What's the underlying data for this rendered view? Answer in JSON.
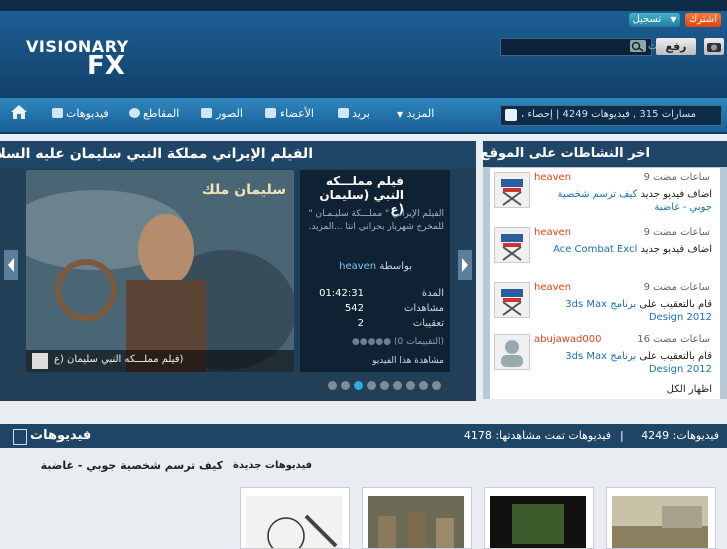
{
  "header": {
    "logo_top": "VISIONARY",
    "logo_bottom": "FX",
    "subscribe_label": "اشترك",
    "login_label": "تسجيل",
    "search_placeholder": "بحث",
    "search_go_label": "رفع"
  },
  "nav": {
    "items": [
      {
        "label": "فيديوهات"
      },
      {
        "label": "المقاطع"
      },
      {
        "label": "الصور"
      },
      {
        "label": "الأعضاء"
      },
      {
        "label": "بريد"
      },
      {
        "label": "المزيد"
      }
    ],
    "stats": "مسارات 315 , فيديوهات 4249 | إحصاء ،"
  },
  "featured": {
    "title": "الفيلم الإيراني مملكة النبي سليمان عليه السلام",
    "info_title": "فيلم مملـــكه النبي (سليمان (ع",
    "description": "الفيلم الإيراني \" مملـــكة سليـمـان \" للمخرج شهريار بحراني انتا ...المزيد.",
    "by_label": "بواسطة",
    "author": "heaven",
    "duration_label": "المدة",
    "duration": "01:42:31",
    "views_label": "مشاهدات",
    "views": "542",
    "comments_label": "تعقيبات",
    "comments": "2",
    "rating": "(التقييمات 0)",
    "watch_label": "مشاهدة هذا الفيديو",
    "caption": "(فيلم مملـــكه النبي سليمان (ع",
    "poster_text": "سليمان ملك"
  },
  "activity": {
    "title": "اخر النشاطات على الموقع",
    "items": [
      {
        "time": "9 ساعات مضت",
        "user": "heaven",
        "action": "اضاف فيديو جديد",
        "target": "كيف ترسم شخصية جوبي - غاضبة"
      },
      {
        "time": "9 ساعات مضت",
        "user": "heaven",
        "action": "اضاف فيديو جديد",
        "target": "Ace Combat Excl"
      },
      {
        "time": "9 ساعات مضت",
        "user": "heaven",
        "action": "قام بالتعقيب على",
        "target": "برنامج 3ds Max Design 2012"
      },
      {
        "time": "16 ساعات مضت",
        "user": "abujawad000",
        "action": "قام بالتعقيب على",
        "target": "برنامج 3ds Max Design 2012"
      }
    ],
    "more_label": "اظهار الكل"
  },
  "videos": {
    "title": "فيديوهات",
    "count_label": "فيديوهات: 4249",
    "views_label": "فيديوهات تمت مشاهدتها: 4178",
    "new_label": "فيديوهات جديدة",
    "featured_title": "كيف ترسم شخصية جوبي - غاضبة"
  },
  "colors": {
    "header": "#1d5f94",
    "nav": "#2e86be",
    "panel": "#1f4666",
    "accent": "#32a9e0",
    "link": "#1d6fb8",
    "orange": "#e0440f"
  }
}
